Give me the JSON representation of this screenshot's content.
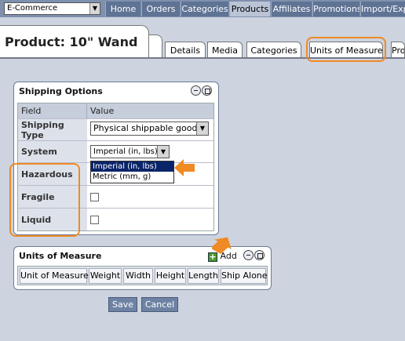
{
  "nav": {
    "app_select": "E-Commerce",
    "tabs": [
      "Home",
      "Orders",
      "Categories",
      "Products",
      "Affiliates",
      "Promotions",
      "Import/Exp"
    ]
  },
  "product": {
    "title": "Product: 10\" Wand",
    "tabs": [
      "Details",
      "Media",
      "Categories",
      "Units of Measure",
      "Pro"
    ]
  },
  "shipping": {
    "title": "Shipping Options",
    "col_field": "Field",
    "col_value": "Value",
    "fields": {
      "shipping_type": "Shipping Type",
      "system": "System",
      "hazardous": "Hazardous",
      "fragile": "Fragile",
      "liquid": "Liquid"
    },
    "shipping_type_value": "Physical shippable goods",
    "system_value": "Imperial (in, lbs)",
    "system_options": [
      "Imperial (in, lbs)",
      "Metric (mm, g)"
    ]
  },
  "uom": {
    "title": "Units of Measure",
    "add_label": "Add",
    "columns": [
      "Unit of Measure",
      "Weight",
      "Width",
      "Height",
      "Length",
      "Ship Alone"
    ]
  },
  "actions": {
    "save": "Save",
    "cancel": "Cancel"
  },
  "colors": {
    "highlight": "#f08a24",
    "nav_bg": "#5f7394",
    "page_bg": "#cdd3df"
  }
}
